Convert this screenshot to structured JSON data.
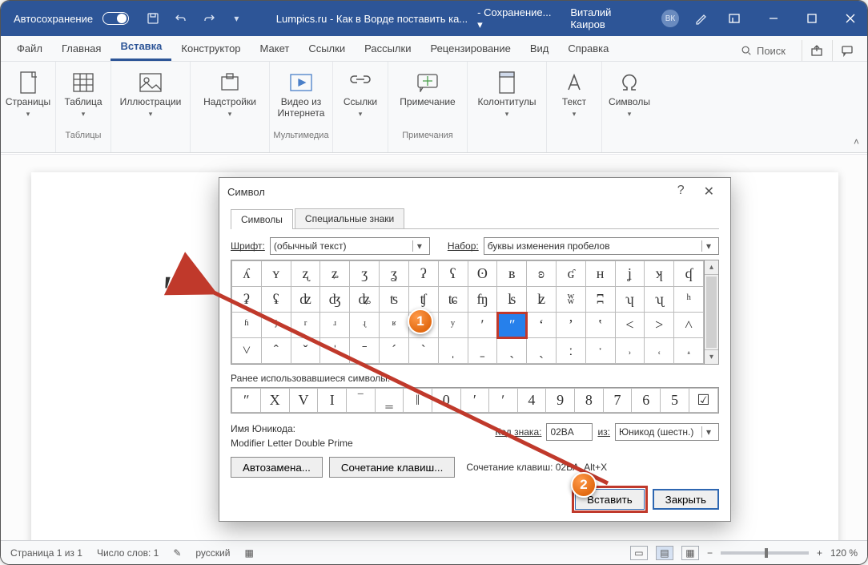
{
  "titlebar": {
    "autosave": "Автосохранение",
    "doc_title": "Lumpics.ru - Как в Ворде поставить ка...",
    "save_status": "- Сохранение... ▾",
    "user": "Виталий Каиров",
    "avatar_initials": "ВК"
  },
  "tabs": {
    "file": "Файл",
    "home": "Главная",
    "insert": "Вставка",
    "design": "Конструктор",
    "layout": "Макет",
    "references": "Ссылки",
    "mailings": "Рассылки",
    "review": "Рецензирование",
    "view": "Вид",
    "help": "Справка",
    "search": "Поиск"
  },
  "ribbon": {
    "pages": "Страницы",
    "table": "Таблица",
    "tables_group": "Таблицы",
    "illustrations": "Иллюстрации",
    "addins": "Надстройки",
    "video": "Видео из Интернета",
    "media_group": "Мультимедиа",
    "links": "Ссылки",
    "comment": "Примечание",
    "comments_group": "Примечания",
    "headers": "Колонтитулы",
    "text": "Текст",
    "symbols": "Символы"
  },
  "document": {
    "quote_char": "ʺ"
  },
  "statusbar": {
    "page": "Страница 1 из 1",
    "words": "Число слов: 1",
    "lang": "русский",
    "zoom": "120 %"
  },
  "dialog": {
    "title": "Символ",
    "tab_symbols": "Символы",
    "tab_special": "Специальные знаки",
    "font_label": "Шрифт:",
    "font_value": "(обычный текст)",
    "set_label": "Набор:",
    "set_value": "буквы изменения пробелов",
    "grid": [
      [
        "ʎ",
        "ʏ",
        "ʐ",
        "ʑ",
        "ʒ",
        "ʓ",
        "ʔ",
        "ʕ",
        "ʘ",
        "ʙ",
        "ʚ",
        "ʛ",
        "ʜ",
        "ʝ",
        "ʞ",
        "ʠ"
      ],
      [
        "ʡ",
        "ʢ",
        "ʣ",
        "ʤ",
        "ʥ",
        "ʦ",
        "ʧ",
        "ʨ",
        "ʩ",
        "ʪ",
        "ʫ",
        "ʬ",
        "ʭ",
        "ʮ",
        "ʯ",
        "ʰ"
      ],
      [
        "ʱ",
        "ʲ",
        "ʳ",
        "ʴ",
        "ʵ",
        "ʶ",
        "ʷ",
        "ʸ",
        "ʹ",
        "ʺ",
        "ʻ",
        "ʼ",
        "ʽ",
        "˂",
        "˃",
        "˄"
      ],
      [
        "˅",
        "ˆ",
        "ˇ",
        "ˈ",
        "ˉ",
        "ˊ",
        "ˋ",
        "ˌ",
        "ˍ",
        "ˎ",
        "ˏ",
        "ː",
        "ˑ",
        "˒",
        "˓",
        "˔"
      ]
    ],
    "selected_row": 2,
    "selected_col": 9,
    "recent_label": "Ранее использовавшиеся символы:",
    "recent": [
      "ʺ",
      "X",
      "V",
      "I",
      "‾",
      "‗",
      "‖",
      "0",
      "′",
      "ʹ",
      "4",
      "9",
      "8",
      "7",
      "6",
      "5",
      "☑"
    ],
    "uname_label": "Имя Юникода:",
    "uname_value": "Modifier Letter Double Prime",
    "code_label": "Код знака:",
    "code_value": "02BA",
    "from_label": "из:",
    "from_value": "Юникод (шестн.)",
    "autocorrect": "Автозамена...",
    "shortcut": "Сочетание клавиш...",
    "shortcut_label": "Сочетание клавиш: 02BA, Alt+X",
    "insert": "Вставить",
    "close": "Закрыть"
  },
  "callouts": {
    "one": "1",
    "two": "2"
  }
}
